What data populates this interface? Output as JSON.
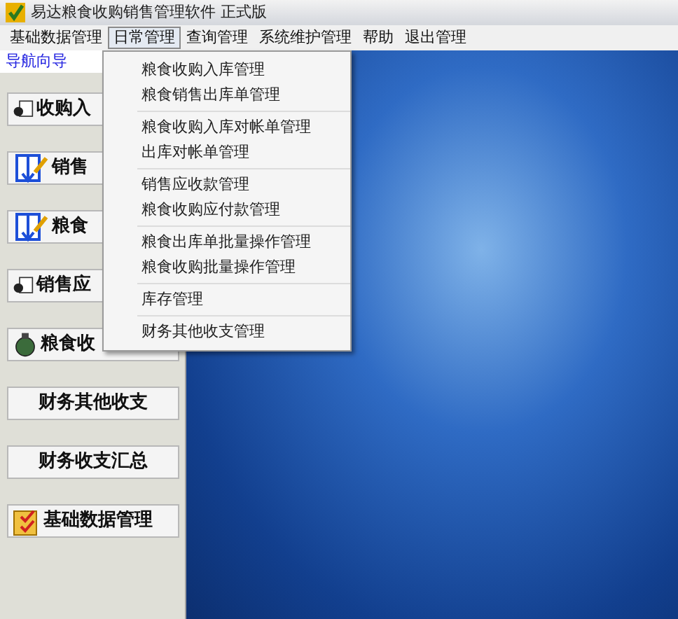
{
  "window": {
    "title": "易达粮食收购销售管理软件 正式版"
  },
  "menu_bar": [
    {
      "label": "基础数据管理",
      "selected": false
    },
    {
      "label": "日常管理",
      "selected": true
    },
    {
      "label": "查询管理",
      "selected": false
    },
    {
      "label": "系统维护管理",
      "selected": false
    },
    {
      "label": "帮助",
      "selected": false
    },
    {
      "label": "退出管理",
      "selected": false
    }
  ],
  "dropdown": {
    "groups": [
      [
        "粮食收购入库管理",
        "粮食销售出库单管理"
      ],
      [
        "粮食收购入库对帐单管理",
        "出库对帐单管理"
      ],
      [
        "销售应收款管理",
        "粮食收购应付款管理"
      ],
      [
        "粮食出库单批量操作管理",
        "粮食收购批量操作管理"
      ],
      [
        "库存管理"
      ],
      [
        "财务其他收支管理"
      ]
    ]
  },
  "nav": {
    "title": "导航向导",
    "buttons": [
      {
        "label": "收购入",
        "kind": "doc"
      },
      {
        "label": "销售",
        "kind": "book"
      },
      {
        "label": "粮食",
        "kind": "book"
      },
      {
        "label": "销售应",
        "kind": "doc"
      },
      {
        "label": "粮食收",
        "kind": "money"
      },
      {
        "label": "财务其他收支",
        "kind": "plain"
      },
      {
        "label": "财务收支汇总",
        "kind": "plain"
      },
      {
        "label": "基础数据管理",
        "kind": "folder"
      }
    ]
  }
}
